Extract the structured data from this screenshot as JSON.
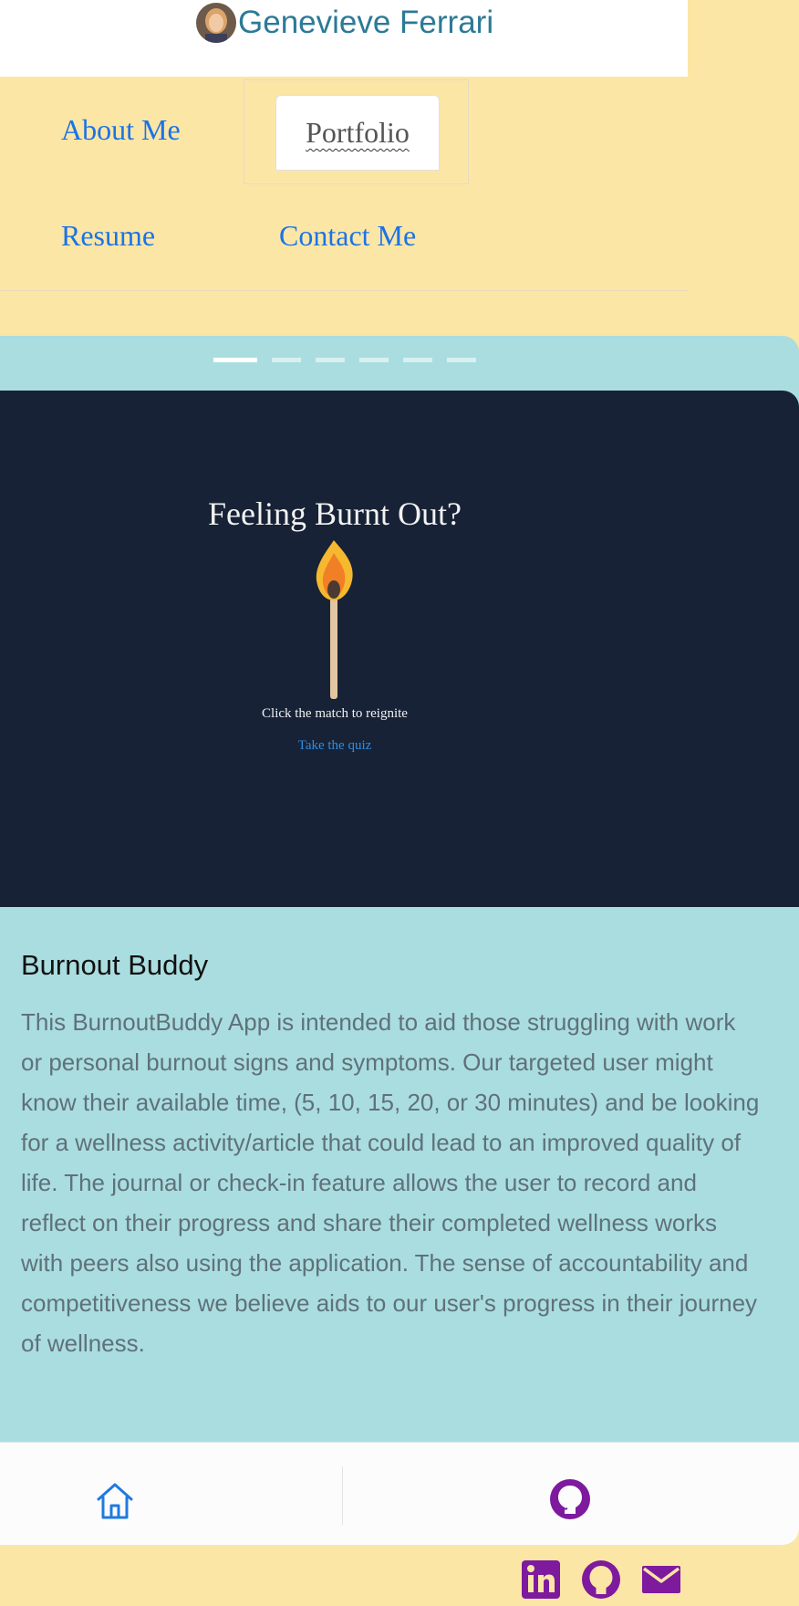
{
  "colors": {
    "page_bg": "#fce6a6",
    "brand_text": "#2c7a96",
    "nav_link": "#1a73e8",
    "card_bg": "#aadde0",
    "slide_bg": "#172236",
    "social_icons": "#7d1a9e",
    "home_icon": "#1f7ae0"
  },
  "header": {
    "name": "Genevieve Ferrari",
    "avatar_icon": "profile-photo"
  },
  "nav": {
    "items": [
      {
        "label": "About Me",
        "active": false
      },
      {
        "label": "Portfolio",
        "active": true
      },
      {
        "label": "Resume",
        "active": false
      },
      {
        "label": "Contact Me",
        "active": false
      }
    ]
  },
  "carousel": {
    "slide_count": 6,
    "active_index": 0,
    "slide": {
      "title": "Feeling Burnt Out?",
      "image_icon": "match-flame",
      "caption": "Click the match to reignite",
      "link": "Take the quiz"
    }
  },
  "project": {
    "title": "Burnout Buddy",
    "description": "This BurnoutBuddy App is intended to aid those struggling with work or personal burnout signs and symptoms. Our targeted user might know their available time, (5, 10, 15, 20, or 30 minutes) and be looking for a wellness activity/article that could lead to an improved quality of life. The journal or check-in feature allows the user to record and reflect on their progress and share their completed wellness works with peers also using the application. The sense of accountability and competitiveness we believe aids to our user's progress in their journey of wellness."
  },
  "card_footer": {
    "home_icon": "home-icon",
    "repo_icon": "github-icon"
  },
  "socials": [
    "linkedin-icon",
    "github-icon",
    "email-icon"
  ]
}
